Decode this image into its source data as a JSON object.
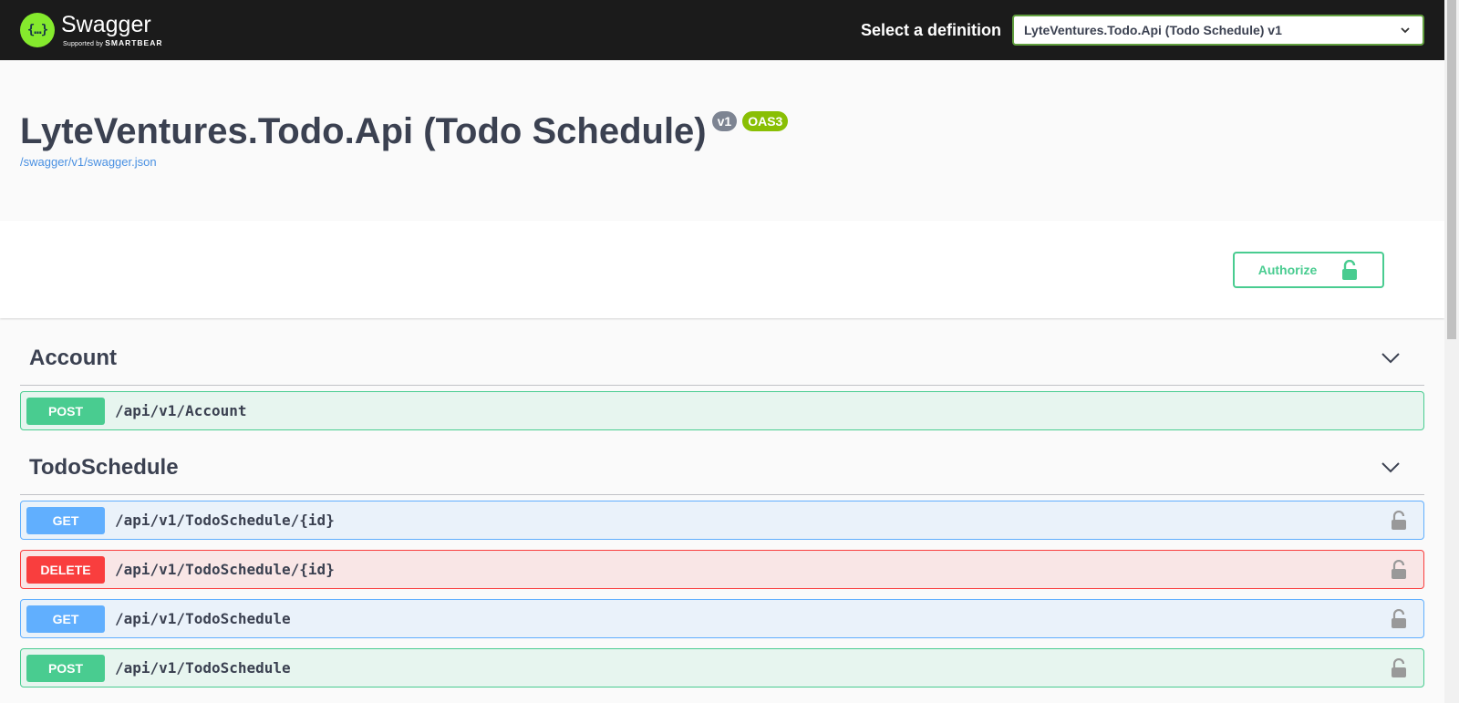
{
  "topbar": {
    "logo_glyph": "{…}",
    "brand_name": "Swagger",
    "brand_sub_prefix": "Supported by",
    "brand_sub_company": "SMARTBEAR",
    "definition_label": "Select a definition",
    "definition_selected": "LyteVentures.Todo.Api (Todo Schedule) v1"
  },
  "info": {
    "title": "LyteVentures.Todo.Api (Todo Schedule)",
    "version_badge": "v1",
    "oas_badge": "OAS3",
    "spec_url": "/swagger/v1/swagger.json"
  },
  "authorize": {
    "label": "Authorize"
  },
  "tags": [
    {
      "name": "Account",
      "operations": [
        {
          "method": "POST",
          "path": "/api/v1/Account",
          "locked": false
        }
      ]
    },
    {
      "name": "TodoSchedule",
      "operations": [
        {
          "method": "GET",
          "path": "/api/v1/TodoSchedule/{id}",
          "locked": true
        },
        {
          "method": "DELETE",
          "path": "/api/v1/TodoSchedule/{id}",
          "locked": true
        },
        {
          "method": "GET",
          "path": "/api/v1/TodoSchedule",
          "locked": true
        },
        {
          "method": "POST",
          "path": "/api/v1/TodoSchedule",
          "locked": true
        }
      ]
    }
  ],
  "colors": {
    "post": "#49cc90",
    "get": "#61affe",
    "delete": "#f93e3e",
    "topbar": "#1b1b1b",
    "brand_green": "#85ea2d",
    "oas_badge": "#89bf04",
    "version_badge": "#7d8492"
  }
}
